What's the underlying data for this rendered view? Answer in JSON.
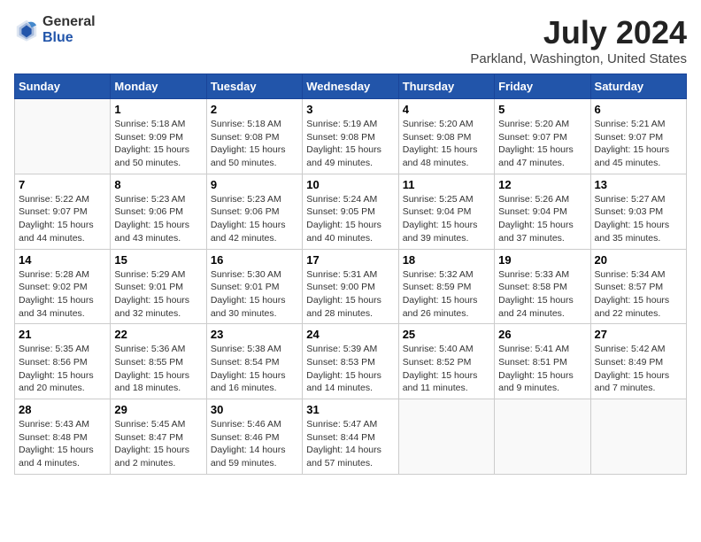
{
  "logo": {
    "general": "General",
    "blue": "Blue"
  },
  "title": "July 2024",
  "subtitle": "Parkland, Washington, United States",
  "days_of_week": [
    "Sunday",
    "Monday",
    "Tuesday",
    "Wednesday",
    "Thursday",
    "Friday",
    "Saturday"
  ],
  "weeks": [
    [
      {
        "day": "",
        "info": ""
      },
      {
        "day": "1",
        "info": "Sunrise: 5:18 AM\nSunset: 9:09 PM\nDaylight: 15 hours\nand 50 minutes."
      },
      {
        "day": "2",
        "info": "Sunrise: 5:18 AM\nSunset: 9:08 PM\nDaylight: 15 hours\nand 50 minutes."
      },
      {
        "day": "3",
        "info": "Sunrise: 5:19 AM\nSunset: 9:08 PM\nDaylight: 15 hours\nand 49 minutes."
      },
      {
        "day": "4",
        "info": "Sunrise: 5:20 AM\nSunset: 9:08 PM\nDaylight: 15 hours\nand 48 minutes."
      },
      {
        "day": "5",
        "info": "Sunrise: 5:20 AM\nSunset: 9:07 PM\nDaylight: 15 hours\nand 47 minutes."
      },
      {
        "day": "6",
        "info": "Sunrise: 5:21 AM\nSunset: 9:07 PM\nDaylight: 15 hours\nand 45 minutes."
      }
    ],
    [
      {
        "day": "7",
        "info": "Sunrise: 5:22 AM\nSunset: 9:07 PM\nDaylight: 15 hours\nand 44 minutes."
      },
      {
        "day": "8",
        "info": "Sunrise: 5:23 AM\nSunset: 9:06 PM\nDaylight: 15 hours\nand 43 minutes."
      },
      {
        "day": "9",
        "info": "Sunrise: 5:23 AM\nSunset: 9:06 PM\nDaylight: 15 hours\nand 42 minutes."
      },
      {
        "day": "10",
        "info": "Sunrise: 5:24 AM\nSunset: 9:05 PM\nDaylight: 15 hours\nand 40 minutes."
      },
      {
        "day": "11",
        "info": "Sunrise: 5:25 AM\nSunset: 9:04 PM\nDaylight: 15 hours\nand 39 minutes."
      },
      {
        "day": "12",
        "info": "Sunrise: 5:26 AM\nSunset: 9:04 PM\nDaylight: 15 hours\nand 37 minutes."
      },
      {
        "day": "13",
        "info": "Sunrise: 5:27 AM\nSunset: 9:03 PM\nDaylight: 15 hours\nand 35 minutes."
      }
    ],
    [
      {
        "day": "14",
        "info": "Sunrise: 5:28 AM\nSunset: 9:02 PM\nDaylight: 15 hours\nand 34 minutes."
      },
      {
        "day": "15",
        "info": "Sunrise: 5:29 AM\nSunset: 9:01 PM\nDaylight: 15 hours\nand 32 minutes."
      },
      {
        "day": "16",
        "info": "Sunrise: 5:30 AM\nSunset: 9:01 PM\nDaylight: 15 hours\nand 30 minutes."
      },
      {
        "day": "17",
        "info": "Sunrise: 5:31 AM\nSunset: 9:00 PM\nDaylight: 15 hours\nand 28 minutes."
      },
      {
        "day": "18",
        "info": "Sunrise: 5:32 AM\nSunset: 8:59 PM\nDaylight: 15 hours\nand 26 minutes."
      },
      {
        "day": "19",
        "info": "Sunrise: 5:33 AM\nSunset: 8:58 PM\nDaylight: 15 hours\nand 24 minutes."
      },
      {
        "day": "20",
        "info": "Sunrise: 5:34 AM\nSunset: 8:57 PM\nDaylight: 15 hours\nand 22 minutes."
      }
    ],
    [
      {
        "day": "21",
        "info": "Sunrise: 5:35 AM\nSunset: 8:56 PM\nDaylight: 15 hours\nand 20 minutes."
      },
      {
        "day": "22",
        "info": "Sunrise: 5:36 AM\nSunset: 8:55 PM\nDaylight: 15 hours\nand 18 minutes."
      },
      {
        "day": "23",
        "info": "Sunrise: 5:38 AM\nSunset: 8:54 PM\nDaylight: 15 hours\nand 16 minutes."
      },
      {
        "day": "24",
        "info": "Sunrise: 5:39 AM\nSunset: 8:53 PM\nDaylight: 15 hours\nand 14 minutes."
      },
      {
        "day": "25",
        "info": "Sunrise: 5:40 AM\nSunset: 8:52 PM\nDaylight: 15 hours\nand 11 minutes."
      },
      {
        "day": "26",
        "info": "Sunrise: 5:41 AM\nSunset: 8:51 PM\nDaylight: 15 hours\nand 9 minutes."
      },
      {
        "day": "27",
        "info": "Sunrise: 5:42 AM\nSunset: 8:49 PM\nDaylight: 15 hours\nand 7 minutes."
      }
    ],
    [
      {
        "day": "28",
        "info": "Sunrise: 5:43 AM\nSunset: 8:48 PM\nDaylight: 15 hours\nand 4 minutes."
      },
      {
        "day": "29",
        "info": "Sunrise: 5:45 AM\nSunset: 8:47 PM\nDaylight: 15 hours\nand 2 minutes."
      },
      {
        "day": "30",
        "info": "Sunrise: 5:46 AM\nSunset: 8:46 PM\nDaylight: 14 hours\nand 59 minutes."
      },
      {
        "day": "31",
        "info": "Sunrise: 5:47 AM\nSunset: 8:44 PM\nDaylight: 14 hours\nand 57 minutes."
      },
      {
        "day": "",
        "info": ""
      },
      {
        "day": "",
        "info": ""
      },
      {
        "day": "",
        "info": ""
      }
    ]
  ]
}
